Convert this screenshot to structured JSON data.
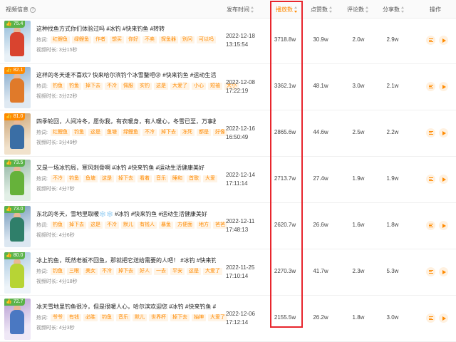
{
  "header": {
    "video_info": "视频信息",
    "publish_time": "发布时间",
    "plays": "播放数",
    "likes": "点赞数",
    "comments": "评论数",
    "shares": "分享数",
    "actions": "操作"
  },
  "hot_label": "热词:",
  "duration_label": "视频时长:",
  "rows": [
    {
      "score": "75.4",
      "title": "这种找鱼方式你们体验过吗 #冰钓 #快来钓鱼 #转转",
      "tags": [
        "红鲤鱼",
        "绿鲤鱼",
        "作者",
        "想买",
        "你好",
        "不卖",
        "探鱼器",
        "别问",
        "可以吗"
      ],
      "duration": "3分15秒",
      "date": "2022-12-18",
      "time": "13:15:54",
      "plays": "3718.8w",
      "likes": "30.9w",
      "comments": "2.0w",
      "shares": "2.9w"
    },
    {
      "score": "82.1",
      "title": "这样的冬天谁不喜欢? 快来哈尔滨钓个冰雪鳌吧😜 #快来钓鱼 #运动生活...",
      "tags": [
        "钓鱼",
        "钓鱼",
        "掉下去",
        "不冷",
        "佩服",
        "实钓",
        "这是",
        "大爱了",
        "小心",
        "短袖",
        "大小"
      ],
      "duration": "3分22秒",
      "date": "2022-12-08",
      "time": "17:22:19",
      "plays": "3362.1w",
      "likes": "48.1w",
      "comments": "3.0w",
      "shares": "2.1w"
    },
    {
      "score": "81.0",
      "title": "四季轮回，人间冷冬，愿你我，有衣暖身，有人暖心，冬雪已至，万事胜...",
      "tags": [
        "红鲤鱼",
        "钓鱼",
        "这是",
        "鱼塘",
        "绿鲤鱼",
        "不冷",
        "掉下去",
        "冻死",
        "都是",
        "好像"
      ],
      "duration": "3分49秒",
      "date": "2022-12-16",
      "time": "16:50:49",
      "plays": "2865.6w",
      "likes": "44.6w",
      "comments": "2.5w",
      "shares": "2.2w"
    },
    {
      "score": "73.5",
      "title": "又是一场冰钓局，寒风刺骨啊 #冰钓 #快来钓鱼 #运动生活健康美好",
      "tags": [
        "不冷",
        "钓鱼",
        "鱼塘",
        "这是",
        "掉下去",
        "看着",
        "音乐",
        "睡和",
        "首歌",
        "大爱"
      ],
      "duration": "4分7秒",
      "date": "2022-12-14",
      "time": "17:11:14",
      "plays": "2713.7w",
      "likes": "27.4w",
      "comments": "1.9w",
      "shares": "1.9w"
    },
    {
      "score": "73.0",
      "title": "东北的冬天，雪地里取暖❄️❄️ #冰钓 #快来钓鱼 #运动生活健康美好",
      "tags": [
        "钓鱼",
        "掉下去",
        "这是",
        "不冷",
        "默儿",
        "有钱人",
        "暴鱼",
        "方便面",
        "地方",
        "爸爸"
      ],
      "duration": "4分6秒",
      "date": "2022-12-11",
      "time": "17:48:13",
      "plays": "2620.7w",
      "likes": "26.6w",
      "comments": "1.6w",
      "shares": "1.8w"
    },
    {
      "score": "80.0",
      "title": "冰上钓鱼，既然老板不回鱼，那就把它送给需要的人吧！ #冰钓 #快来钓鱼 ...",
      "tags": [
        "钓鱼",
        "三眼",
        "美女",
        "不冷",
        "掉下去",
        "好人",
        "一去",
        "平安",
        "这是",
        "大爱了"
      ],
      "duration": "4分18秒",
      "date": "2022-11-25",
      "time": "17:10:14",
      "plays": "2270.3w",
      "likes": "41.7w",
      "comments": "2.3w",
      "shares": "5.3w"
    },
    {
      "score": "72.7",
      "title": "冰天雪地里钓鱼很冷，但是很暖人心，哈尔滨欢迎您 #冰钓 #快来钓鱼 #运...",
      "tags": [
        "爷爷",
        "有钱",
        "必胜",
        "钓鱼",
        "音乐",
        "默儿",
        "世界杯",
        "掉下去",
        "抽神",
        "大爱了"
      ],
      "duration": "4分3秒",
      "date": "2022-12-06",
      "time": "17:12:14",
      "plays": "2155.5w",
      "likes": "26.2w",
      "comments": "1.8w",
      "shares": "3.0w"
    }
  ],
  "colors": {
    "accent": "#ff8a00",
    "highlight": "#e8262d",
    "score_green": "#5bb34a"
  }
}
